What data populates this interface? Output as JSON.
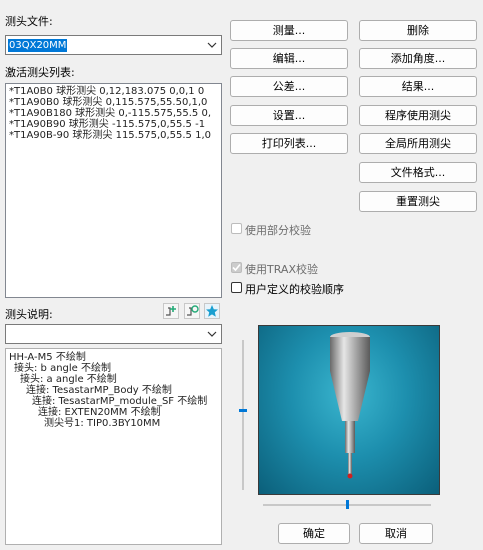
{
  "probe_file": {
    "label": "测头文件:",
    "value": "03QX20MM"
  },
  "active_tips": {
    "label": "激活测尖列表:",
    "items": [
      "*T1A0B0  球形测尖  0,12,183.075  0,0,1 0",
      "*T1A90B0  球形测尖  0,115.575,55.50,1,0",
      "*T1A90B180  球形测尖  0,-115.575,55.5 0,",
      "*T1A90B90  球形测尖  -115.575,0,55.5 -1",
      "*T1A90B-90  球形测尖  115.575,0,55.5 1,0"
    ]
  },
  "buttons": {
    "measure": "测量...",
    "delete": "删除",
    "edit": "编辑...",
    "add_angle": "添加角度...",
    "tolerance": "公差...",
    "results": "结果...",
    "settings": "设置...",
    "program_tips": "程序使用测尖",
    "print_list": "打印列表...",
    "global_tips": "全局所用测尖",
    "file_format": "文件格式...",
    "reset_tips": "重置测尖",
    "ok": "确定",
    "cancel": "取消"
  },
  "options": {
    "partial_check": "使用部分校验",
    "trax_check": "使用TRAX校验",
    "user_order": "用户定义的校验顺序"
  },
  "probe_description": {
    "label": "测头说明:",
    "combo_value": "",
    "tree": [
      "HH-A-M5  不绘制",
      "  接头: b angle  不绘制",
      "    接头: a angle  不绘制",
      "      连接: TesastarMP_Body  不绘制",
      "        连接: TesastarMP_module_SF  不绘制",
      "          连接: EXTEN20MM  不绘制",
      "            测尖号1: TIP0.3BY10MM"
    ]
  },
  "icons": {
    "add_component": "add-component-icon",
    "edit_component": "edit-component-icon",
    "favorite": "star-icon"
  },
  "colors": {
    "accent": "#0078d7",
    "preview_bg": "#1d8fae"
  }
}
